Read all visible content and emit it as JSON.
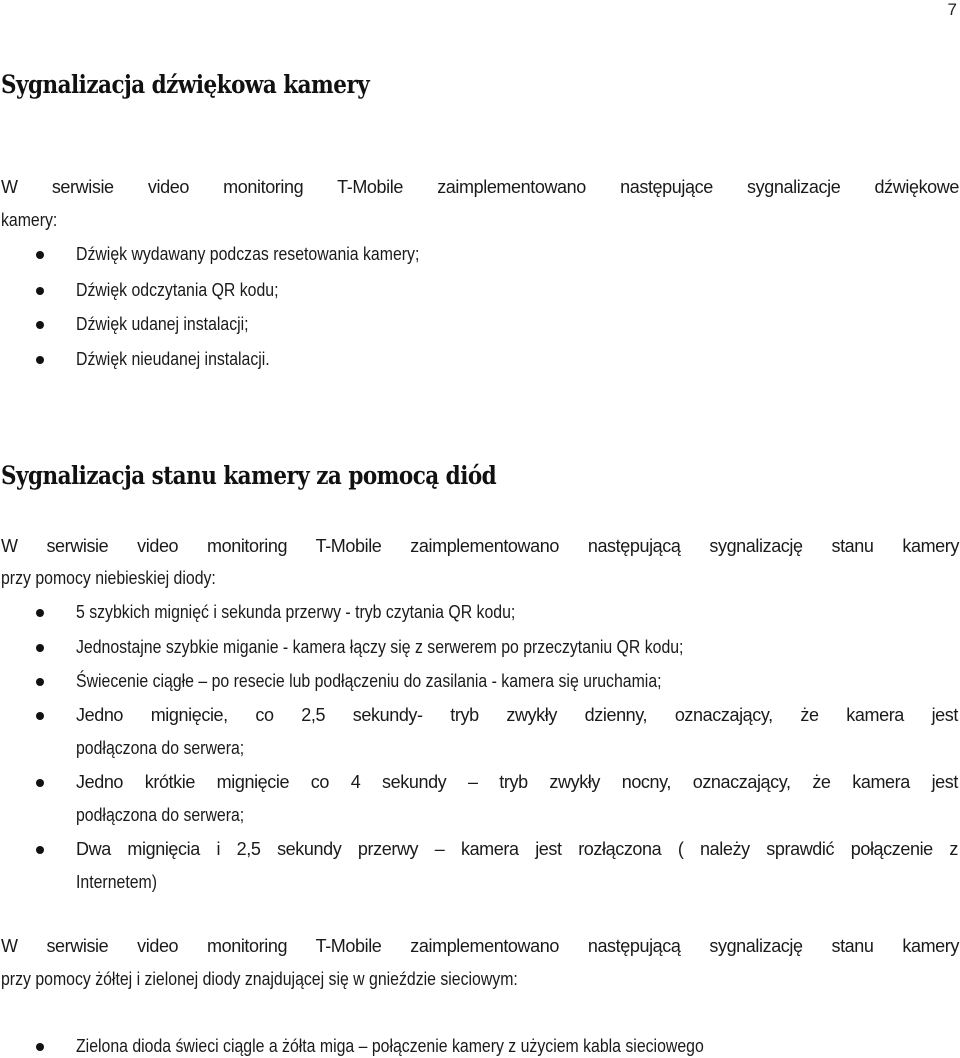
{
  "page_number": "7",
  "section1": {
    "title": "Sygnalizacja dźwiękowa kamery",
    "intro_line1": "W serwisie video monitoring T-Mobile zaimplementowano następujące sygnalizacje dźwiękowe",
    "intro_line2": "kamery:",
    "items": [
      "Dźwięk wydawany podczas resetowania kamery;",
      "Dźwięk odczytania QR kodu;",
      "Dźwięk udanej instalacji;",
      "Dźwięk nieudanej instalacji."
    ]
  },
  "section2": {
    "title": "Sygnalizacja stanu kamery za pomocą diód",
    "intro_line1": " W serwisie video monitoring T-Mobile zaimplementowano następującą sygnalizację stanu kamery",
    "intro_line2": "przy pomocy niebieskiej diody:",
    "items": [
      {
        "line1": "5 szybkich mignięć i sekunda przerwy - tryb czytania QR kodu;"
      },
      {
        "line1": "Jednostajne szybkie miganie - kamera łączy się z serwerem po przeczytaniu QR kodu;"
      },
      {
        "line1": "Świecenie ciągłe – po resecie lub podłączeniu do zasilania - kamera się uruchamia;"
      },
      {
        "line1": "Jedno mignięcie, co 2,5 sekundy- tryb zwykły dzienny, oznaczający, że kamera jest",
        "line2": "podłączona do serwera;"
      },
      {
        "line1": "Jedno krótkie mignięcie co 4 sekundy – tryb zwykły nocny,  oznaczający, że kamera jest",
        "line2": "podłączona do serwera;"
      },
      {
        "line1": "Dwa mignięcia i 2,5 sekundy przerwy – kamera jest rozłączona ( należy sprawdić połączenie z",
        "line2": "Internetem)"
      }
    ],
    "intro2_line1": "W serwisie video monitoring T-Mobile zaimplementowano następującą sygnalizację stanu kamery",
    "intro2_line2": "przy pomocy żółtej i zielonej diody znajdującej się w gnieździe sieciowym:",
    "items2": [
      "Zielona dioda świeci ciągle a żółta miga – połączenie kamery z użyciem kabla sieciowego"
    ]
  }
}
